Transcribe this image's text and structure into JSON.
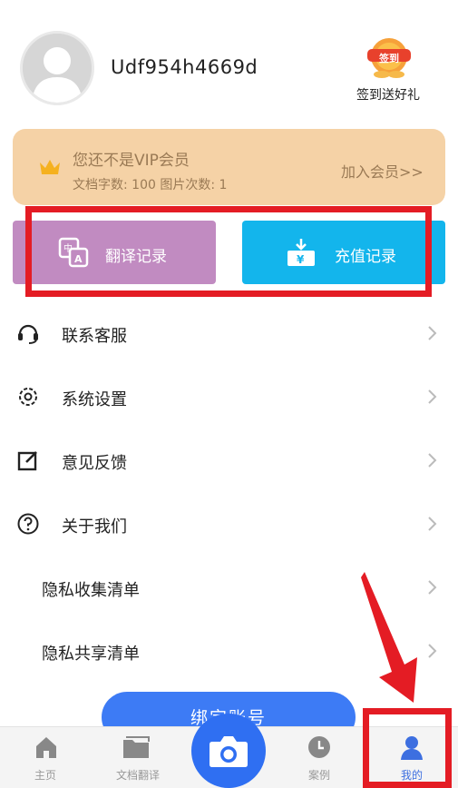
{
  "profile": {
    "username": "Udf954h4669d",
    "signin_badge": "签到",
    "signin_text": "签到送好礼"
  },
  "vip": {
    "title": "您还不是VIP会员",
    "quota": "文档字数: 100  图片次数: 1",
    "join": "加入会员>>"
  },
  "actions": {
    "translate_records": "翻译记录",
    "recharge_records": "充值记录"
  },
  "menu": {
    "items": [
      {
        "label": "联系客服",
        "icon": "headset-icon"
      },
      {
        "label": "系统设置",
        "icon": "gear-icon"
      },
      {
        "label": "意见反馈",
        "icon": "edit-icon"
      },
      {
        "label": "关于我们",
        "icon": "question-icon"
      },
      {
        "label": "隐私收集清单",
        "icon": ""
      },
      {
        "label": "隐私共享清单",
        "icon": ""
      }
    ]
  },
  "bind_button": "绑定账号",
  "tabbar": {
    "items": [
      {
        "label": "主页",
        "icon": "home-icon"
      },
      {
        "label": "文档翻译",
        "icon": "folder-icon"
      },
      {
        "label": "",
        "icon": "camera-icon"
      },
      {
        "label": "案例",
        "icon": "clock-icon"
      },
      {
        "label": "我的",
        "icon": "person-icon"
      }
    ]
  },
  "colors": {
    "vip_bg": "#f5d2a6",
    "vip_text": "#9a7a55",
    "translate_btn": "#c18bc1",
    "recharge_btn": "#13b5ec",
    "primary_blue": "#3d7bf5",
    "annotation_red": "#e41c24"
  }
}
